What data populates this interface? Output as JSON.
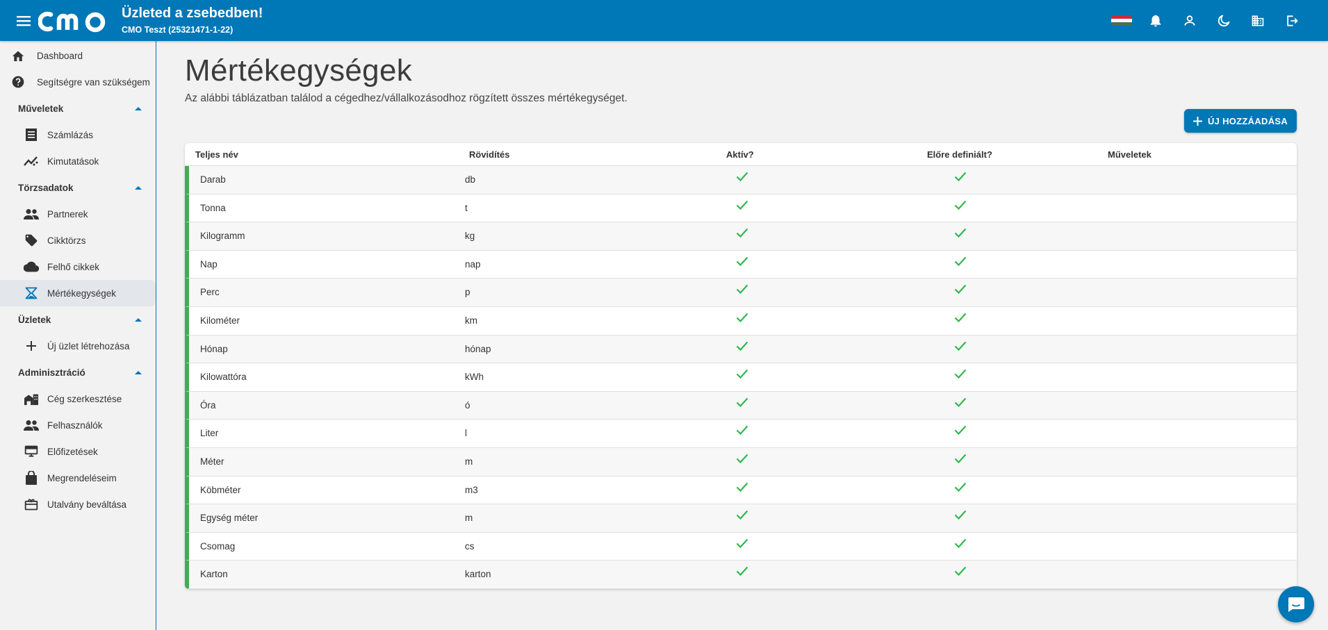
{
  "header": {
    "logo_text": "cmo",
    "title": "Üzleted a zsebedben!",
    "company": "CMO Teszt (25321471-1-22)",
    "icons": [
      "menu-icon",
      "hungarian-flag-icon",
      "bell-icon",
      "user-icon",
      "dark-mode-icon",
      "company-icon",
      "logout-icon"
    ],
    "flag_colors": [
      "#ce2939",
      "#ffffff",
      "#477050"
    ]
  },
  "sidebar": {
    "top_items": [
      {
        "label": "Dashboard",
        "icon": "home-icon"
      },
      {
        "label": "Segítségre van szükségem",
        "icon": "help-icon"
      }
    ],
    "sections": [
      {
        "title": "Műveletek",
        "items": [
          {
            "label": "Számlázás",
            "icon": "invoice-icon"
          },
          {
            "label": "Kimutatások",
            "icon": "chart-icon"
          }
        ]
      },
      {
        "title": "Törzsadatok",
        "items": [
          {
            "label": "Partnerek",
            "icon": "people-icon"
          },
          {
            "label": "Cikktörzs",
            "icon": "tag-icon"
          },
          {
            "label": "Felhő cikkek",
            "icon": "cloud-icon"
          },
          {
            "label": "Mértékegységek",
            "icon": "scale-icon",
            "active": true
          }
        ]
      },
      {
        "title": "Üzletek",
        "items": [
          {
            "label": "Új üzlet létrehozása",
            "icon": "plus-icon"
          }
        ]
      },
      {
        "title": "Adminisztráció",
        "items": [
          {
            "label": "Cég szerkesztése",
            "icon": "company-edit-icon"
          },
          {
            "label": "Felhasználók",
            "icon": "people-icon"
          },
          {
            "label": "Előfizetések",
            "icon": "subscription-icon"
          },
          {
            "label": "Megrendeléseim",
            "icon": "shopping-bag-icon"
          },
          {
            "label": "Utalvány beváltása",
            "icon": "gift-card-icon"
          }
        ]
      }
    ]
  },
  "main": {
    "title": "Mértékegységek",
    "description": "Az alábbi táblázatban találod a cégedhez/vállalkozásodhoz rögzített összes mértékegységet.",
    "add_button": "ÚJ HOZZÁADÁSA",
    "table": {
      "headers": [
        "Teljes név",
        "Rövidítés",
        "Aktív?",
        "Előre definiált?",
        "Műveletek"
      ],
      "rows": [
        {
          "name": "Darab",
          "abbr": "db",
          "active": true,
          "predefined": true
        },
        {
          "name": "Tonna",
          "abbr": "t",
          "active": true,
          "predefined": true
        },
        {
          "name": "Kilogramm",
          "abbr": "kg",
          "active": true,
          "predefined": true
        },
        {
          "name": "Nap",
          "abbr": "nap",
          "active": true,
          "predefined": true
        },
        {
          "name": "Perc",
          "abbr": "p",
          "active": true,
          "predefined": true
        },
        {
          "name": "Kilométer",
          "abbr": "km",
          "active": true,
          "predefined": true
        },
        {
          "name": "Hónap",
          "abbr": "hónap",
          "active": true,
          "predefined": true
        },
        {
          "name": "Kilowattóra",
          "abbr": "kWh",
          "active": true,
          "predefined": true
        },
        {
          "name": "Óra",
          "abbr": "ó",
          "active": true,
          "predefined": true
        },
        {
          "name": "Liter",
          "abbr": "l",
          "active": true,
          "predefined": true
        },
        {
          "name": "Méter",
          "abbr": "m",
          "active": true,
          "predefined": true
        },
        {
          "name": "Köbméter",
          "abbr": "m3",
          "active": true,
          "predefined": true
        },
        {
          "name": "Egység méter",
          "abbr": "m",
          "active": true,
          "predefined": true
        },
        {
          "name": "Csomag",
          "abbr": "cs",
          "active": true,
          "predefined": true
        },
        {
          "name": "Karton",
          "abbr": "karton",
          "active": true,
          "predefined": true
        }
      ]
    }
  },
  "colors": {
    "primary": "#0077b6",
    "accent_row": "#3fae4f",
    "check": "#2fb84c"
  },
  "chat_icon": "chat-icon"
}
